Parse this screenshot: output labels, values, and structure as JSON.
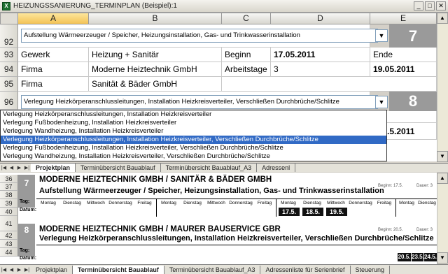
{
  "window": {
    "title": "HEIZUNGSSANIERUNG_TERMINPLAN (Beispiel):1"
  },
  "columns": [
    "A",
    "B",
    "C",
    "D",
    "E"
  ],
  "rows_upper": [
    "92",
    "93",
    "94",
    "95",
    "96"
  ],
  "row92": {
    "dropdown_value": "Aufstellung Wärmeerzeuger / Speicher, Heizungsinstallation, Gas- und Trinkwasserinstallation",
    "number": "7"
  },
  "row93": {
    "a": "Gewerk",
    "b": "Heizung + Sanitär",
    "c": "Beginn",
    "d": "17.05.2011",
    "e": "Ende"
  },
  "row94": {
    "a": "Firma",
    "b": "Moderne Heiztechnik GmbH",
    "c": "Arbeitstage",
    "d": "3",
    "e": "19.05.2011"
  },
  "row95": {
    "a": "Firma",
    "b": "Sanität & Bäder GmbH"
  },
  "row96": {
    "dropdown_value": "Verlegung Heizkörperanschlussleitungen, Installation Heizkreisverteiler, Verschließen Durchbrüche/Schlitze",
    "number": "8"
  },
  "dropdown_list": [
    "Verlegung Heizkörperanschlussleitungen, Installation Heizkreisverteiler",
    "Verlegung Fußbodenheizung, Installation Heizkreisverteiler",
    "Verlegung Wandheizung, Installation Heizkreisverteiler",
    "Verlegung Heizkörperanschlussleitungen, Installation Heizkreisverteiler, Verschließen Durchbrüche/Schlitze",
    "Verlegung Fußbodenheizung, Installation Heizkreisverteiler, Verschließen Durchbrüche/Schlitze",
    "Verlegung Wandheizung, Installation Heizkreisverteiler, Verschließen Durchbrüche/Schlitze"
  ],
  "hidden_partial": ".5.2011",
  "tabs_upper": [
    "Projektplan",
    "Terminübersicht Bauablauf",
    "Terminübersicht Bauablauf_A3",
    "Adressenl"
  ],
  "tabs_lower": [
    "Projektplan",
    "Terminübersicht Bauablauf",
    "Terminübersicht Bauablauf_A3",
    "Adressenliste für Serienbrief",
    "Steuerung"
  ],
  "lower": {
    "rows": [
      "36",
      "37",
      "38",
      "39",
      "40",
      "41",
      "42",
      "43",
      "44"
    ],
    "block1": {
      "num": "7",
      "company": "MODERNE HEIZTECHNIK GMBH  /  SANITÄR & BÄDER GMBH",
      "task": "Aufstellung Wärmeerzeuger / Speicher, Heizungsinstallation, Gas- und Trinkwasserinstallation",
      "begin": "Beginn: 17.5.",
      "dauer": "Dauer: 3",
      "dates": [
        "17.5.",
        "18.5.",
        "19.5."
      ]
    },
    "block2": {
      "num": "8",
      "company": "MODERNE HEIZTECHNIK GMBH  /  MAURER BAUSERVICE GBR",
      "task": "Verlegung Heizkörperanschlussleitungen, Installation Heizkreisverteiler, Verschließen Durchbrüche/Schlitze",
      "begin": "Beginn: 20.5.",
      "dauer": "Dauer: 3",
      "dates": [
        "20.5.",
        "23.5.",
        "24.5."
      ]
    },
    "tag_label": "Tag:",
    "datum_label": "Datum:",
    "days": [
      "Montag",
      "Dienstag",
      "Mittwoch",
      "Donnerstag",
      "Freitag"
    ]
  }
}
